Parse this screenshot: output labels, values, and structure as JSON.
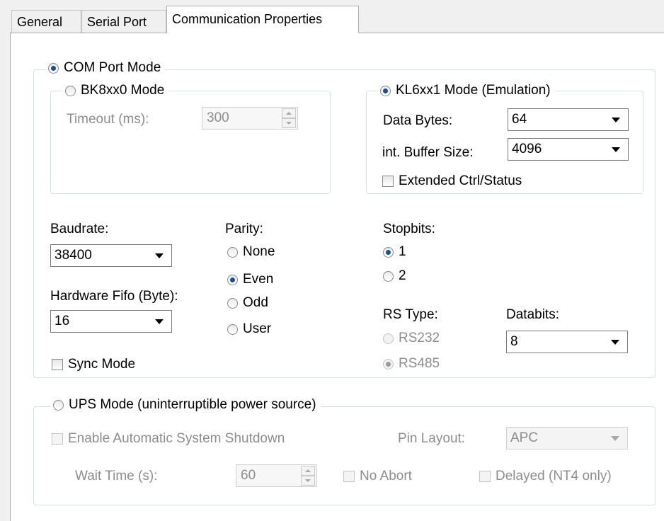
{
  "tabs": [
    "General",
    "Serial Port",
    "Communication Properties"
  ],
  "com_port_mode": {
    "label": "COM Port Mode",
    "selected": true,
    "bk_mode": {
      "label": "BK8xx0 Mode",
      "timeout_label": "Timeout (ms):",
      "timeout_value": "300"
    },
    "kl_mode": {
      "label": "KL6xx1 Mode (Emulation)",
      "data_bytes_label": "Data Bytes:",
      "data_bytes_value": "64",
      "buffer_label": "int. Buffer Size:",
      "buffer_value": "4096",
      "extended_label": "Extended Ctrl/Status"
    },
    "baudrate_label": "Baudrate:",
    "baudrate_value": "38400",
    "fifo_label": "Hardware Fifo (Byte):",
    "fifo_value": "16",
    "sync_label": "Sync Mode",
    "parity_label": "Parity:",
    "parity_options": [
      "None",
      "Even",
      "Odd",
      "User"
    ],
    "parity_selected": "Even",
    "stopbits_label": "Stopbits:",
    "stopbits_options": [
      "1",
      "2"
    ],
    "stopbits_selected": "1",
    "rs_type_label": "RS Type:",
    "rs_type_options": [
      "RS232",
      "RS485"
    ],
    "rs_type_selected": "RS485",
    "databits_label": "Databits:",
    "databits_value": "8"
  },
  "ups_mode": {
    "label": "UPS Mode (uninterruptible power source)",
    "shutdown_label": "Enable Automatic System Shutdown",
    "pin_layout_label": "Pin Layout:",
    "pin_layout_value": "APC",
    "wait_label": "Wait Time (s):",
    "wait_value": "60",
    "no_abort_label": "No Abort",
    "delayed_label": "Delayed (NT4 only)"
  },
  "colors": {
    "panel_bg": "#ffffff",
    "window_bg": "#f0f0f0",
    "disabled_text": "#8d8d8d",
    "radio_dot": "#1b4f8d"
  }
}
